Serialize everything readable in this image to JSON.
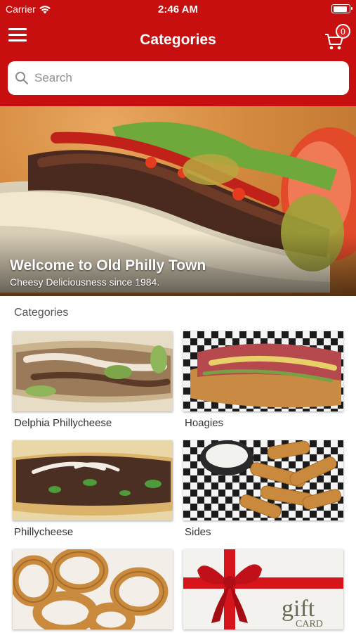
{
  "status_bar": {
    "carrier": "Carrier",
    "time": "2:46 AM",
    "battery_level": 0.9
  },
  "navbar": {
    "title": "Categories",
    "menu_icon": "hamburger-menu-icon",
    "cart_icon": "cart-icon",
    "cart_count": "0"
  },
  "search": {
    "placeholder": "Search",
    "value": ""
  },
  "hero": {
    "title": "Welcome to Old Philly Town",
    "subtitle": "Cheesy Deliciousness since 1984."
  },
  "categories_label": "Categories",
  "categories": [
    {
      "label": "Delphia Phillycheese"
    },
    {
      "label": "Hoagies"
    },
    {
      "label": "Phillycheese"
    },
    {
      "label": "Sides"
    },
    {
      "label": ""
    },
    {
      "label": ""
    }
  ],
  "gift_card": {
    "text_top": "gift",
    "text_bottom": "CARD"
  },
  "colors": {
    "header": "#c80f0f",
    "badge": "#e02020",
    "background": "#ffffff"
  }
}
